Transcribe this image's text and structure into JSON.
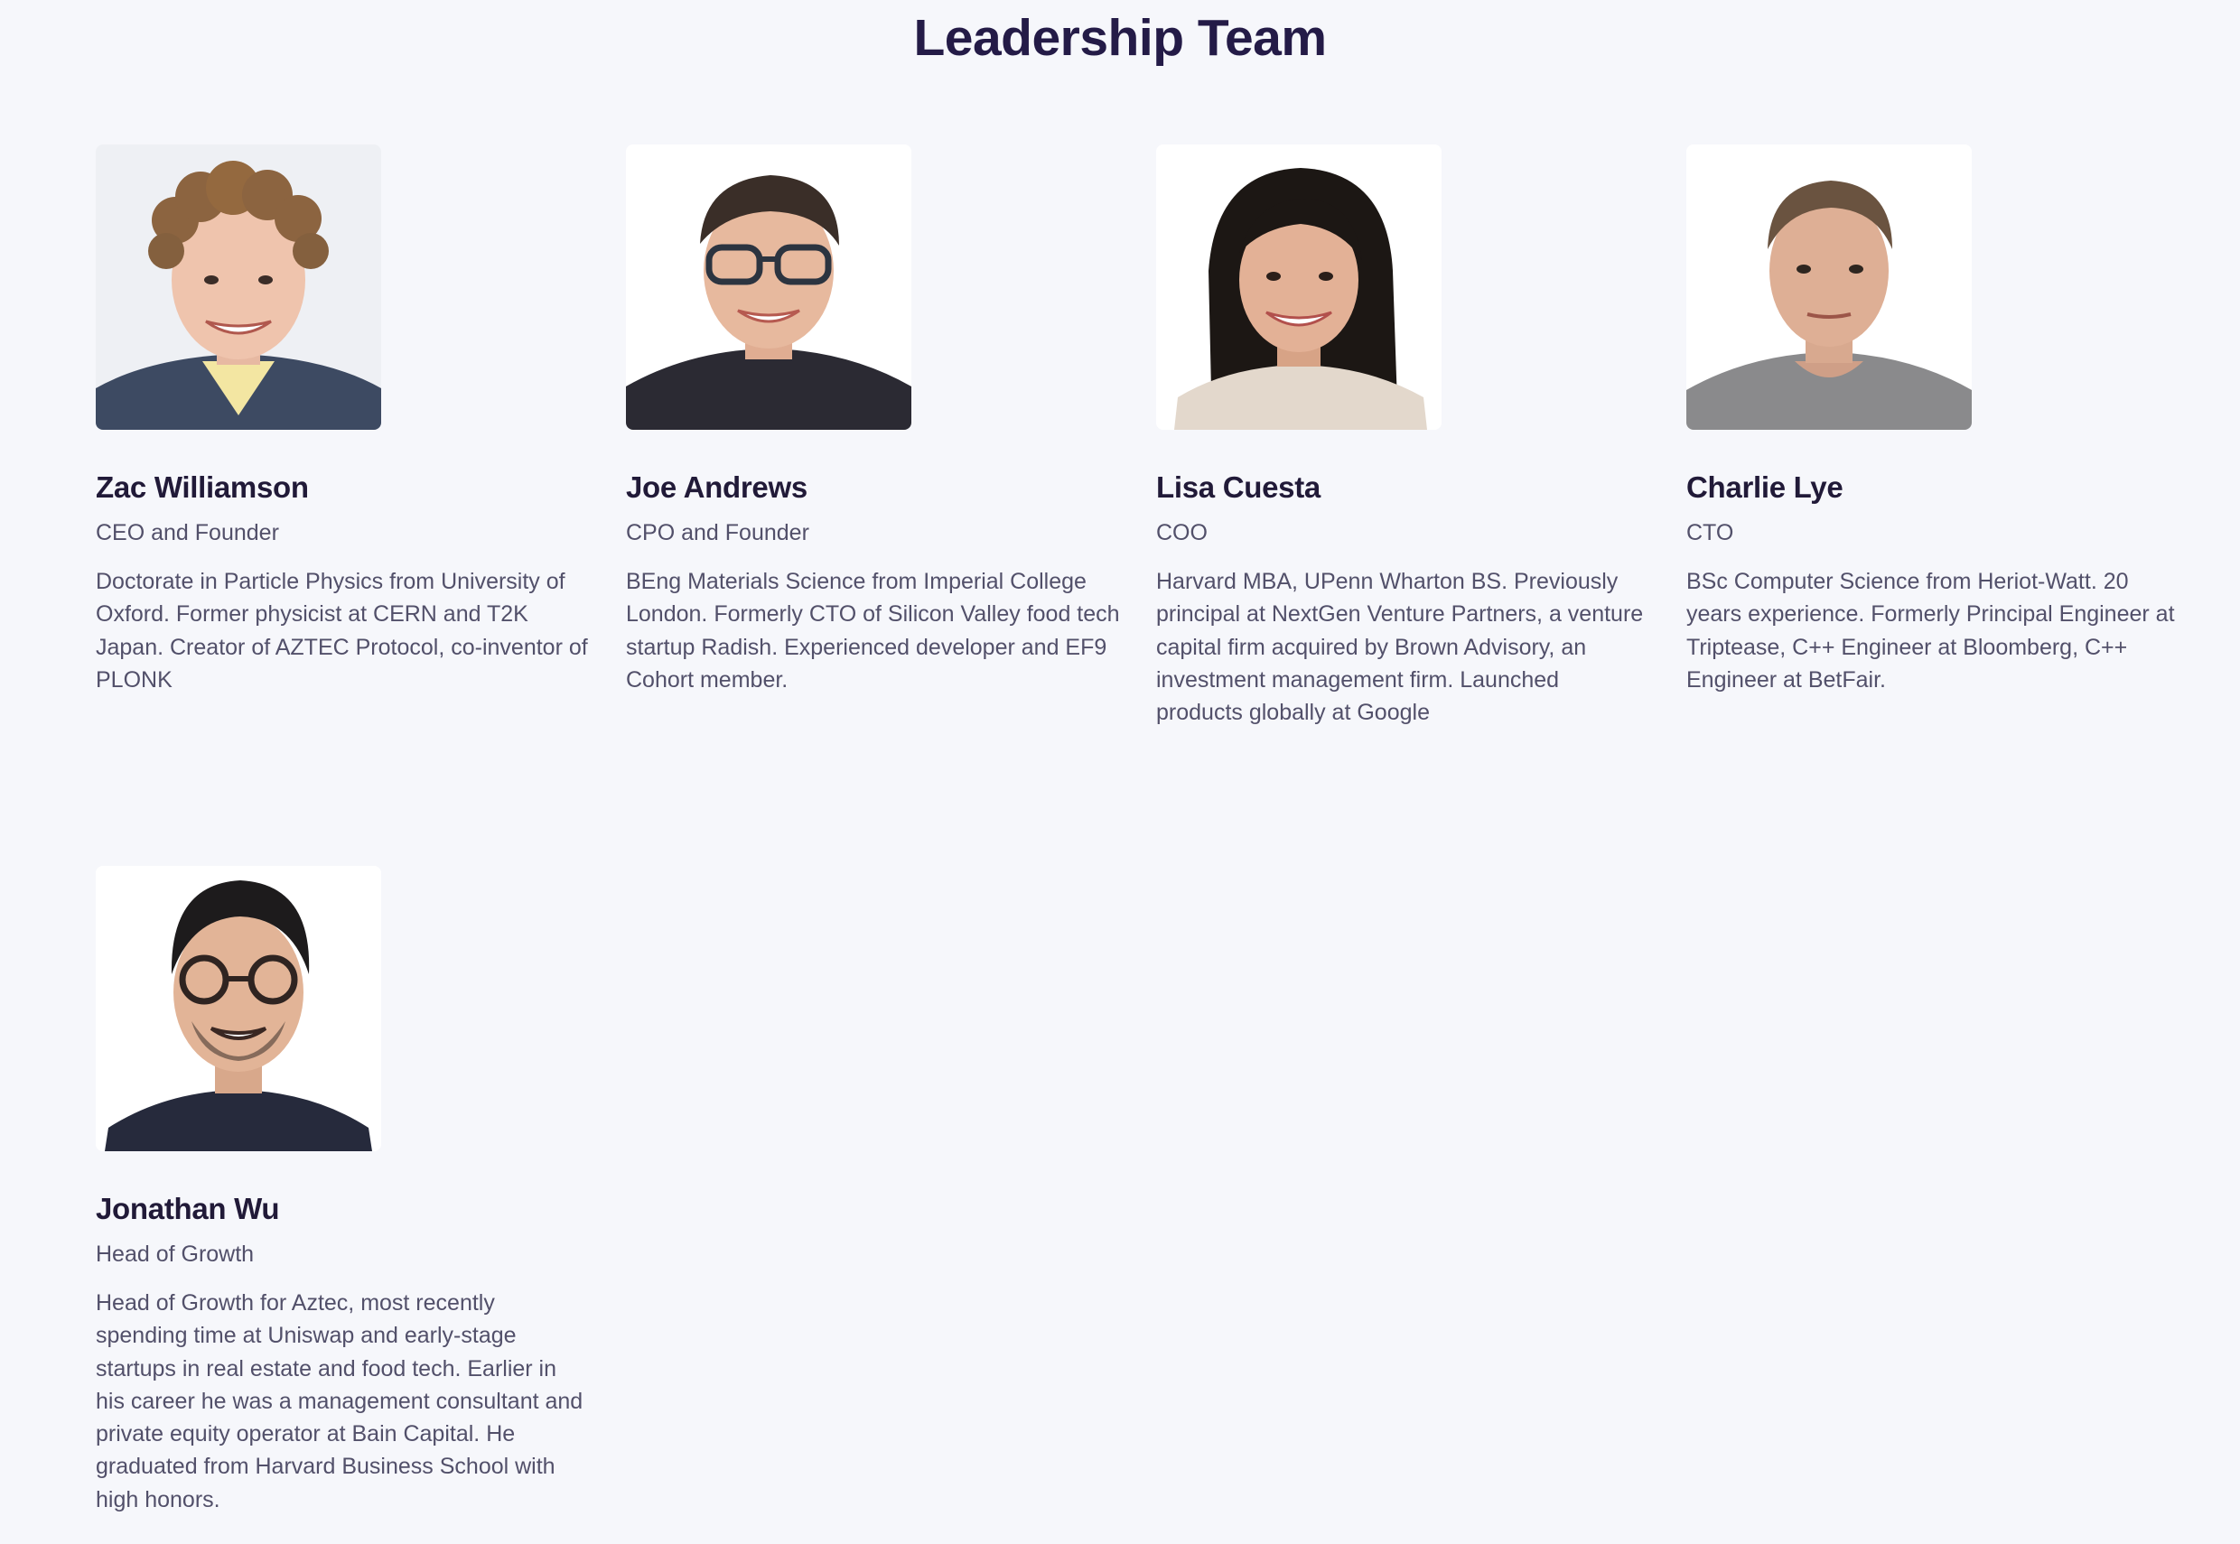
{
  "page": {
    "title": "Leadership Team"
  },
  "team": [
    {
      "name": "Zac Williamson",
      "role": "CEO and Founder",
      "bio": "Doctorate in Particle Physics from University of Oxford. Former physicist at CERN and T2K Japan. Creator of AZTEC Protocol, co-inventor of PLONK"
    },
    {
      "name": "Joe Andrews",
      "role": "CPO and Founder",
      "bio": "BEng Materials Science from Imperial College London. Formerly CTO of Silicon Valley food tech startup Radish. Experienced developer and EF9 Cohort member."
    },
    {
      "name": "Lisa Cuesta",
      "role": "COO",
      "bio": "Harvard MBA, UPenn Wharton BS. Previously principal at NextGen Venture Partners, a venture capital firm acquired by Brown Advisory, an investment management firm. Launched products globally at Google"
    },
    {
      "name": "Charlie Lye",
      "role": "CTO",
      "bio": "BSc Computer Science from Heriot-Watt. 20 years experience. Formerly Principal Engineer at Triptease, C++ Engineer at Bloomberg, C++ Engineer at BetFair."
    },
    {
      "name": "Jonathan Wu",
      "role": "Head of Growth",
      "bio": "Head of Growth for Aztec, most recently spending time at Uniswap and early-stage startups in real estate and food tech. Earlier in his career he was a management consultant and private equity operator at Bain Capital. He graduated from Harvard Business School with high honors."
    }
  ]
}
